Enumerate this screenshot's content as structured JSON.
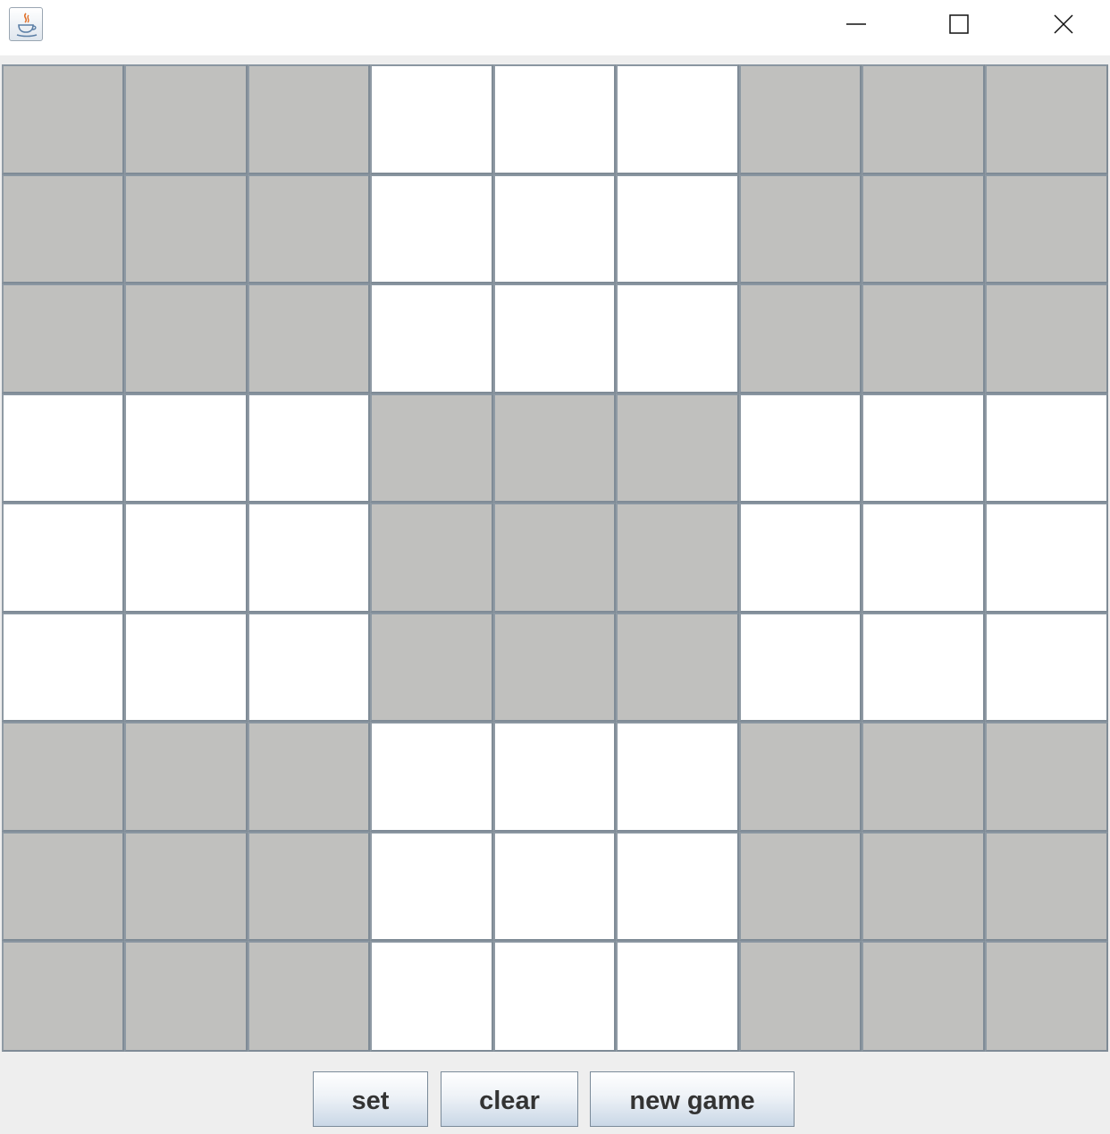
{
  "window": {
    "app_icon": "java-coffee-cup-icon",
    "controls": [
      "minimize-icon",
      "maximize-icon",
      "close-icon"
    ]
  },
  "board": {
    "rows": 9,
    "cols": 9,
    "block_size": 3,
    "shading": [
      [
        "gray",
        "gray",
        "gray",
        "white",
        "white",
        "white",
        "gray",
        "gray",
        "gray"
      ],
      [
        "gray",
        "gray",
        "gray",
        "white",
        "white",
        "white",
        "gray",
        "gray",
        "gray"
      ],
      [
        "gray",
        "gray",
        "gray",
        "white",
        "white",
        "white",
        "gray",
        "gray",
        "gray"
      ],
      [
        "white",
        "white",
        "white",
        "gray",
        "gray",
        "gray",
        "white",
        "white",
        "white"
      ],
      [
        "white",
        "white",
        "white",
        "gray",
        "gray",
        "gray",
        "white",
        "white",
        "white"
      ],
      [
        "white",
        "white",
        "white",
        "gray",
        "gray",
        "gray",
        "white",
        "white",
        "white"
      ],
      [
        "gray",
        "gray",
        "gray",
        "white",
        "white",
        "white",
        "gray",
        "gray",
        "gray"
      ],
      [
        "gray",
        "gray",
        "gray",
        "white",
        "white",
        "white",
        "gray",
        "gray",
        "gray"
      ],
      [
        "gray",
        "gray",
        "gray",
        "white",
        "white",
        "white",
        "gray",
        "gray",
        "gray"
      ]
    ],
    "values": [
      [
        "",
        "",
        "",
        "",
        "",
        "",
        "",
        "",
        ""
      ],
      [
        "",
        "",
        "",
        "",
        "",
        "",
        "",
        "",
        ""
      ],
      [
        "",
        "",
        "",
        "",
        "",
        "",
        "",
        "",
        ""
      ],
      [
        "",
        "",
        "",
        "",
        "",
        "",
        "",
        "",
        ""
      ],
      [
        "",
        "",
        "",
        "",
        "",
        "",
        "",
        "",
        ""
      ],
      [
        "",
        "",
        "",
        "",
        "",
        "",
        "",
        "",
        ""
      ],
      [
        "",
        "",
        "",
        "",
        "",
        "",
        "",
        "",
        ""
      ],
      [
        "",
        "",
        "",
        "",
        "",
        "",
        "",
        "",
        ""
      ],
      [
        "",
        "",
        "",
        "",
        "",
        "",
        "",
        "",
        ""
      ]
    ],
    "colors": {
      "gray": "#c0c0be",
      "white": "#ffffff",
      "grid_line": "#7f8b96"
    }
  },
  "buttons": {
    "set_label": "set",
    "clear_label": "clear",
    "new_game_label": "new game"
  }
}
